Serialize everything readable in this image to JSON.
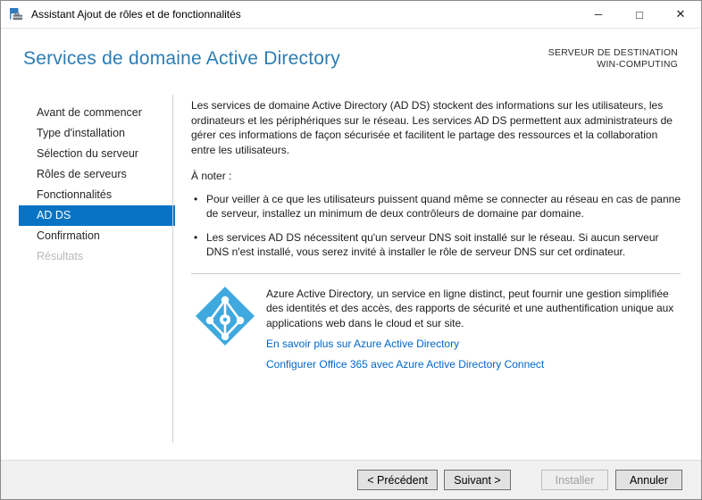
{
  "window": {
    "title": "Assistant Ajout de rôles et de fonctionnalités",
    "controls": {
      "minimize": "─",
      "maximize": "□",
      "close": "✕"
    }
  },
  "header": {
    "page_title": "Services de domaine Active Directory",
    "destination_label": "SERVEUR DE DESTINATION",
    "destination_server": "WIN-COMPUTING"
  },
  "sidebar": {
    "items": [
      {
        "label": "Avant de commencer",
        "state": "enabled"
      },
      {
        "label": "Type d'installation",
        "state": "enabled"
      },
      {
        "label": "Sélection du serveur",
        "state": "enabled"
      },
      {
        "label": "Rôles de serveurs",
        "state": "enabled"
      },
      {
        "label": "Fonctionnalités",
        "state": "enabled"
      },
      {
        "label": "AD DS",
        "state": "selected"
      },
      {
        "label": "Confirmation",
        "state": "enabled"
      },
      {
        "label": "Résultats",
        "state": "disabled"
      }
    ]
  },
  "content": {
    "intro": "Les services de domaine Active Directory (AD DS) stockent des informations sur les utilisateurs, les ordinateurs et les périphériques sur le réseau. Les services AD DS permettent aux administrateurs de gérer ces informations de façon sécurisée et facilitent le partage des ressources et la collaboration entre les utilisateurs.",
    "note_heading": "À noter :",
    "bullet_glyph": "•",
    "notes": [
      "Pour veiller à ce que les utilisateurs puissent quand même se connecter au réseau en cas de panne de serveur, installez un minimum de deux contrôleurs de domaine par domaine.",
      "Les services AD DS nécessitent qu'un serveur DNS soit installé sur le réseau. Si aucun serveur DNS n'est installé, vous serez invité à installer le rôle de serveur DNS sur cet ordinateur."
    ],
    "azure": {
      "description": "Azure Active Directory, un service en ligne distinct, peut fournir une gestion simplifiée des identités et des accès, des rapports de sécurité et une authentification unique aux applications web dans le cloud et sur site.",
      "links": [
        "En savoir plus sur Azure Active Directory",
        "Configurer Office 365 avec Azure Active Directory Connect"
      ]
    }
  },
  "footer": {
    "previous": "< Précédent",
    "next": "Suivant >",
    "install": "Installer",
    "cancel": "Annuler"
  },
  "colors": {
    "nav_selected_bg": "#0873c5",
    "page_title": "#2d7db3",
    "link": "#0066cc",
    "azure_icon": "#3fa9df",
    "footer_bg": "#f0f0f0"
  }
}
